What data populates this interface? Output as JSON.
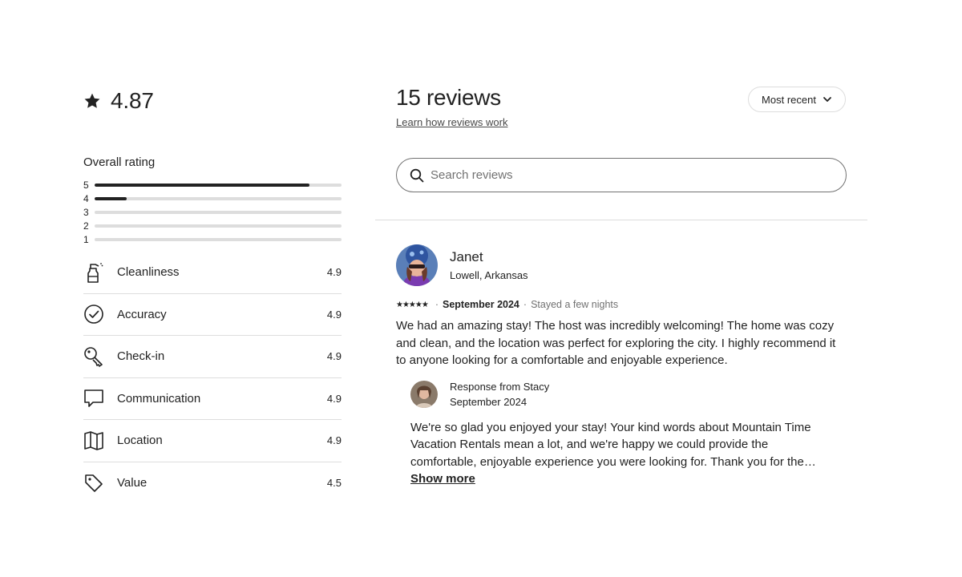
{
  "summary": {
    "average_rating": "4.87",
    "overall_label": "Overall rating",
    "distribution": [
      {
        "label": "5",
        "fraction": 0.87
      },
      {
        "label": "4",
        "fraction": 0.13
      },
      {
        "label": "3",
        "fraction": 0.0
      },
      {
        "label": "2",
        "fraction": 0.0
      },
      {
        "label": "1",
        "fraction": 0.0
      }
    ],
    "categories": [
      {
        "name": "Cleanliness",
        "score": "4.9",
        "icon": "spray-bottle-icon"
      },
      {
        "name": "Accuracy",
        "score": "4.9",
        "icon": "check-circle-icon"
      },
      {
        "name": "Check-in",
        "score": "4.9",
        "icon": "key-icon"
      },
      {
        "name": "Communication",
        "score": "4.9",
        "icon": "chat-bubble-icon"
      },
      {
        "name": "Location",
        "score": "4.9",
        "icon": "map-icon"
      },
      {
        "name": "Value",
        "score": "4.5",
        "icon": "tag-icon"
      }
    ]
  },
  "reviews_header": {
    "title": "15 reviews",
    "learn_link": "Learn how reviews work",
    "sort_label": "Most recent"
  },
  "search": {
    "placeholder": "Search reviews"
  },
  "review": {
    "name": "Janet",
    "location": "Lowell, Arkansas",
    "stars": "★★★★★",
    "date": "September 2024",
    "stay": "Stayed a few nights",
    "text": "We had an amazing stay! The host was incredibly welcoming! The home was cozy and clean, and the location was perfect for exploring the city. I highly recommend it to anyone looking for a comfortable and enjoyable experience.",
    "response": {
      "from": "Response from Stacy",
      "date": "September 2024",
      "text": "We're so glad you enjoyed your stay! Your kind words about Mountain Time Vacation Rentals mean a lot, and we're happy we could provide the comfortable, enjoyable experience you were looking for. Thank you for the…",
      "show_more": "Show more"
    }
  },
  "colors": {
    "text": "#222222",
    "muted": "#717171",
    "border": "#dddddd",
    "bar_fill": "#222222"
  }
}
